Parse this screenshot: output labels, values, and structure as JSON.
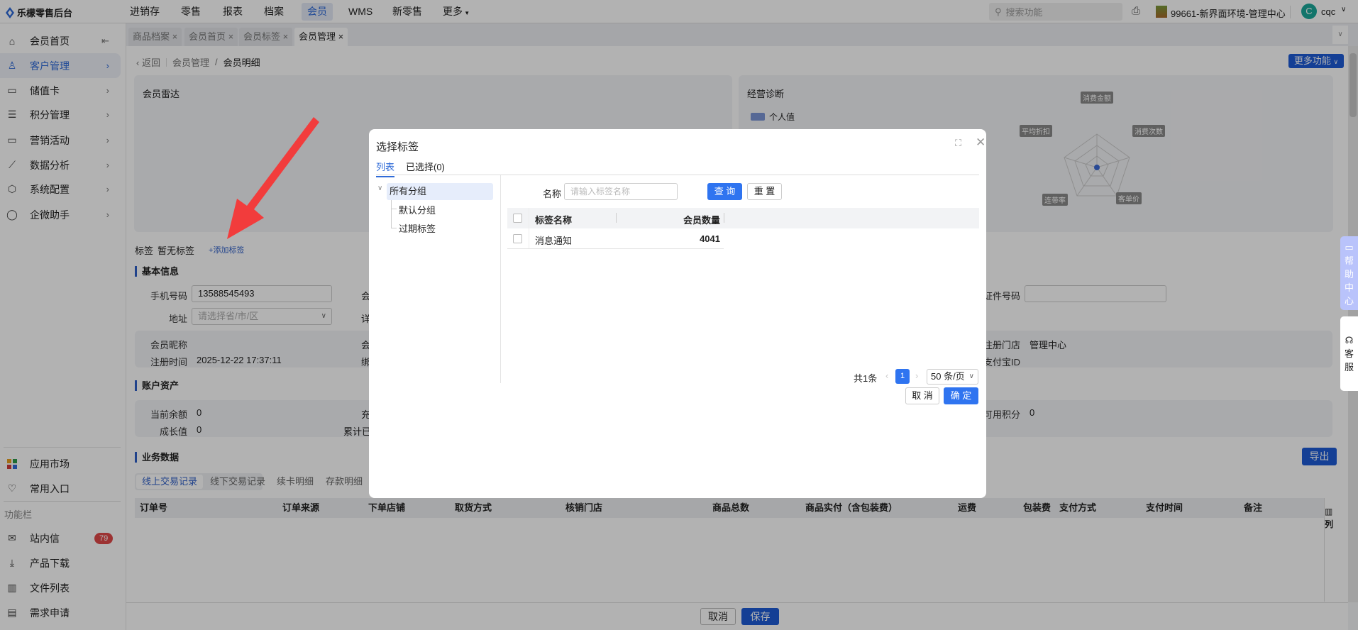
{
  "app": {
    "logo_text": "乐檬零售后台"
  },
  "topnav": [
    "进销存",
    "零售",
    "报表",
    "档案",
    "会员",
    "WMS",
    "新零售",
    "更多"
  ],
  "topnav_active": "会员",
  "search": {
    "placeholder": "搜索功能"
  },
  "store": {
    "name": "99661-新界面环境-管理中心"
  },
  "user": {
    "avatar_letter": "C",
    "name": "cqc"
  },
  "sidebar": {
    "items": [
      {
        "label": "会员首页",
        "icon": "home-icon"
      },
      {
        "label": "客户管理",
        "icon": "user-icon"
      },
      {
        "label": "储值卡",
        "icon": "card-icon"
      },
      {
        "label": "积分管理",
        "icon": "database-icon"
      },
      {
        "label": "营销活动",
        "icon": "monitor-icon"
      },
      {
        "label": "数据分析",
        "icon": "chart-icon"
      },
      {
        "label": "系统配置",
        "icon": "settings-icon"
      },
      {
        "label": "企微助手",
        "icon": "chat-icon"
      }
    ],
    "bottom": [
      {
        "label": "应用市场"
      },
      {
        "label": "常用入口"
      }
    ],
    "section_label": "功能栏",
    "tools": [
      {
        "label": "站内信",
        "badge": "79"
      },
      {
        "label": "产品下载"
      },
      {
        "label": "文件列表"
      },
      {
        "label": "需求申请"
      }
    ]
  },
  "tabs": [
    "商品档案",
    "会员首页",
    "会员标签",
    "会员管理"
  ],
  "breadcrumb": {
    "back": "返回",
    "parent": "会员管理",
    "current": "会员明细"
  },
  "more_functions": "更多功能",
  "radar_card": {
    "title": "会员雷达"
  },
  "diagnosis": {
    "title": "经营诊断",
    "legend": "个人值",
    "axes": [
      "消费金额",
      "消费次数",
      "客单价",
      "连带率",
      "平均折扣"
    ],
    "accent": "#3b6bd6"
  },
  "tags": {
    "label": "标签",
    "value": "暂无标签",
    "add": "+添加标签"
  },
  "basic": {
    "title": "基本信息",
    "phone_label": "手机号码",
    "phone_value": "13588545493",
    "address_label": "地址",
    "address_placeholder": "请选择省/市/区",
    "col2_a": "会",
    "col2_b": "详",
    "id_label": "证件号码",
    "nickname_label": "会员昵称",
    "col2_c": "会",
    "reg_time_label": "注册时间",
    "reg_time_value": "2025-12-22 17:37:11",
    "col2_d": "绑",
    "reg_store_label": "注册门店",
    "reg_store_value": "管理中心",
    "alipay_label": "支付宝ID"
  },
  "assets": {
    "title": "账户资产",
    "balance_label": "当前余额",
    "balance_value": "0",
    "growth_label": "成长值",
    "growth_value": "0",
    "col2_a": "充",
    "col2_b": "累计已",
    "points_label": "可用积分",
    "points_value": "0"
  },
  "business": {
    "title": "业务数据",
    "export": "导出",
    "tabs": [
      "线上交易记录",
      "线下交易记录",
      "续卡明细",
      "存款明细"
    ],
    "columns": [
      "订单号",
      "订单来源",
      "下单店铺",
      "取货方式",
      "核销门店",
      "商品总数",
      "商品实付（含包装费）",
      "运费",
      "包装费",
      "支付方式",
      "支付时间",
      "备注"
    ],
    "col_setting": "列"
  },
  "footer": {
    "cancel": "取消",
    "save": "保存"
  },
  "help": {
    "help_center": "帮助中心",
    "service": "客服"
  },
  "modal": {
    "title": "选择标签",
    "tabs": [
      "列表",
      "已选择(0)"
    ],
    "tree": {
      "root": "所有分组",
      "children": [
        "默认分组",
        "过期标签"
      ]
    },
    "name_label": "名称",
    "name_placeholder": "请输入标签名称",
    "query": "查 询",
    "reset": "重 置",
    "columns": [
      "标签名称",
      "会员数量"
    ],
    "rows": [
      {
        "name": "消息通知",
        "count": "4041"
      }
    ],
    "total": "共1条",
    "page": "1",
    "page_size": "50 条/页",
    "cancel": "取 消",
    "confirm": "确 定"
  }
}
